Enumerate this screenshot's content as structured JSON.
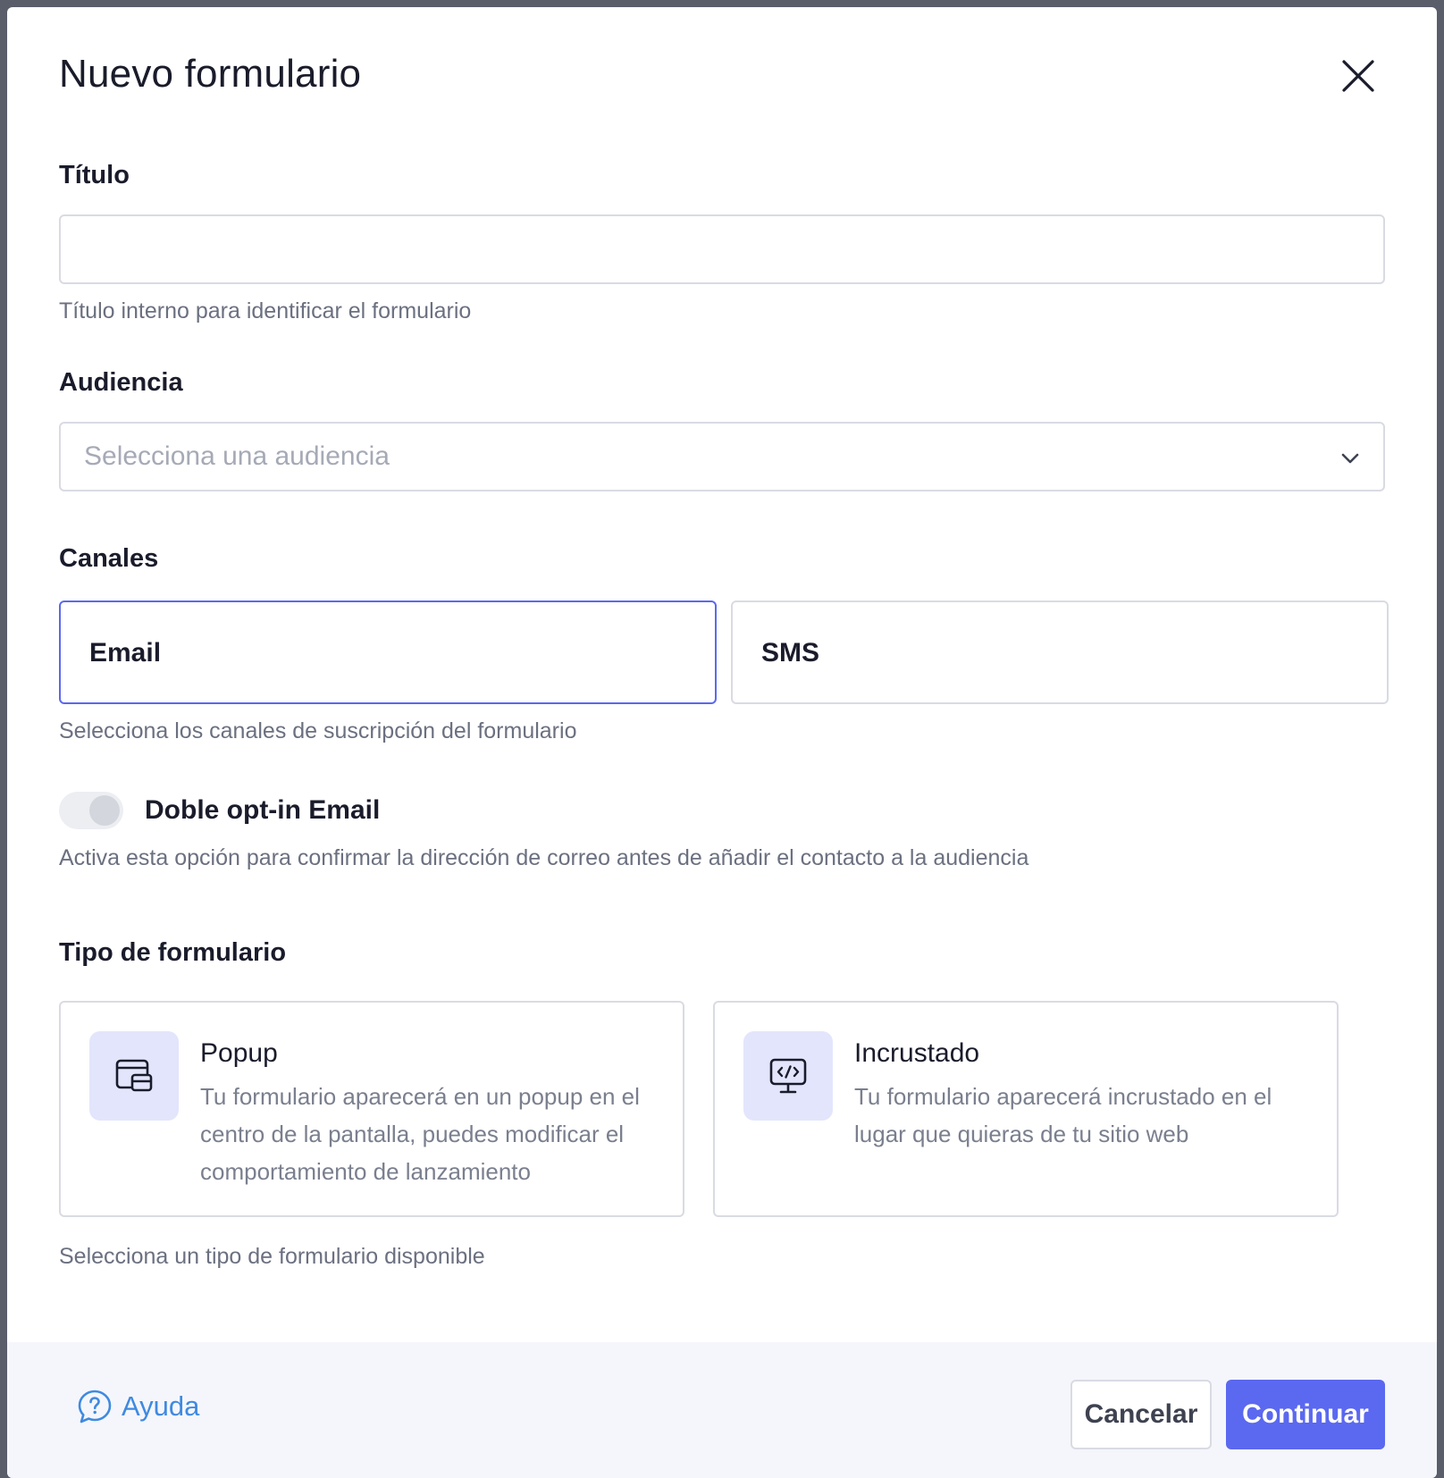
{
  "modal": {
    "title": "Nuevo formulario"
  },
  "title_field": {
    "label": "Título",
    "value": "",
    "hint": "Título interno para identificar el formulario"
  },
  "audience_field": {
    "label": "Audiencia",
    "placeholder": "Selecciona una audiencia"
  },
  "channels": {
    "label": "Canales",
    "options": [
      {
        "label": "Email",
        "selected": true
      },
      {
        "label": "SMS",
        "selected": false
      }
    ],
    "hint": "Selecciona los canales de suscripción del formulario"
  },
  "double_optin": {
    "label": "Doble opt-in Email",
    "enabled": false,
    "hint": "Activa esta opción para confirmar la dirección de correo antes de añadir el contacto a la audiencia"
  },
  "form_type": {
    "label": "Tipo de formulario",
    "options": [
      {
        "title": "Popup",
        "description": "Tu formulario aparecerá en un popup en el centro de la pantalla, puedes modificar el comportamiento de lanzamiento",
        "icon": "popup-window-icon"
      },
      {
        "title": "Incrustado",
        "description": "Tu formulario aparecerá incrustado en el lugar que quieras de tu sitio web",
        "icon": "embed-code-monitor-icon"
      }
    ],
    "hint": "Selecciona un tipo de formulario disponible"
  },
  "footer": {
    "help_label": "Ayuda",
    "cancel_label": "Cancelar",
    "continue_label": "Continuar"
  },
  "colors": {
    "accent": "#5b68f0",
    "link": "#3f8ae0",
    "icon_bg": "#e3e5fc"
  }
}
